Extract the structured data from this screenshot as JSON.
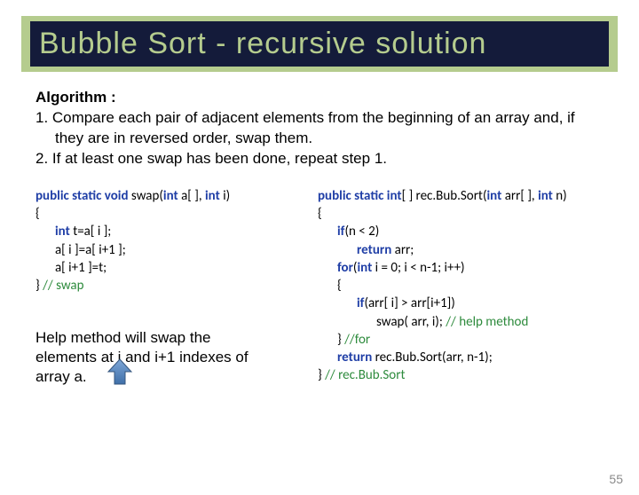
{
  "title": "Bubble Sort  - recursive solution",
  "algorithm": {
    "heading": "Algorithm :",
    "step1": "1. Compare each pair of adjacent elements from the beginning of an array and, if they are in reversed order, swap them.",
    "step2": "2. If at least one swap has been done, repeat step 1."
  },
  "swap_code": {
    "sig_pre": "public static void",
    "sig_name": " swap(",
    "sig_p1": "int",
    "sig_p1b": " a[ ], ",
    "sig_p2": "int",
    "sig_p2b": " i)",
    "open": "{",
    "l1a": "int",
    "l1b": " t=a[ i ];",
    "l2": "a[ i ]=a[ i+1 ];",
    "l3": "a[ i+1 ]=t;",
    "close": "} ",
    "close_cm": "// swap"
  },
  "rec_code": {
    "sig_pre": "public static int",
    "sig_name": "[ ] rec.Bub.Sort(",
    "sig_p1": "int",
    "sig_p1b": " arr[ ], ",
    "sig_p2": "int",
    "sig_p2b": " n)",
    "open": "{",
    "l1a": "if",
    "l1b": "(n < 2)",
    "l2a": "return",
    "l2b": " arr;",
    "l3a": "for",
    "l3b": "(",
    "l3c": "int",
    "l3d": " i = 0; i < n-1; i++)",
    "l4": "{",
    "l5a": "if",
    "l5b": "(arr[ i] > arr[i+1])",
    "l6a": "swap( arr, i); ",
    "l6b": "// help method",
    "l7": "} ",
    "l7b": "//for",
    "l8a": "return",
    "l8b": " rec.Bub.Sort(arr, n-1);",
    "close": "} ",
    "close_cm": "// rec.Bub.Sort"
  },
  "help_note": "Help method will swap the elements at i and i+1 indexes of array a.",
  "page_number": "55"
}
